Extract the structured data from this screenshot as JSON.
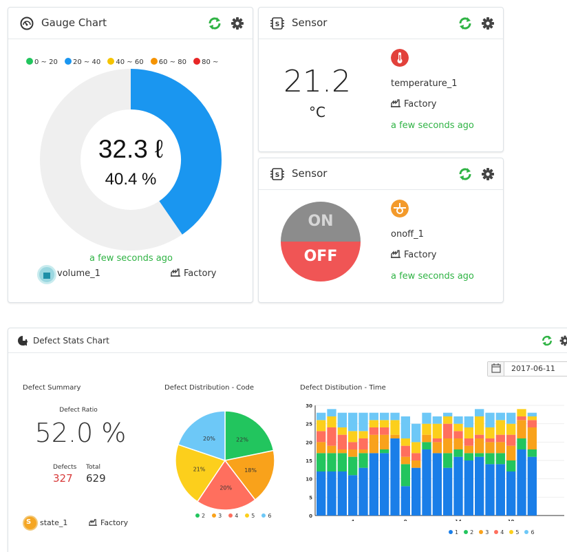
{
  "gauge": {
    "title": "Gauge Chart",
    "legend": [
      {
        "label": "0 ~ 20",
        "color": "#22c55e"
      },
      {
        "label": "20 ~ 40",
        "color": "#1a96f0"
      },
      {
        "label": "40 ~ 60",
        "color": "#f5c400"
      },
      {
        "label": "60 ~ 80",
        "color": "#f59300"
      },
      {
        "label": "80 ~",
        "color": "#e82626"
      }
    ],
    "value": "32.3 ℓ",
    "percent": "40.4 %",
    "percent_value": 40.4,
    "fill_color": "#1a96f0",
    "updated": "a few seconds ago",
    "sensor_name": "volume_1",
    "location": "Factory"
  },
  "sensor1": {
    "title": "Sensor",
    "value": "21.2",
    "unit": "°C",
    "name": "temperature_1",
    "location": "Factory",
    "updated": "a few seconds ago",
    "icon": "thermometer-icon"
  },
  "sensor2": {
    "title": "Sensor",
    "on_label": "ON",
    "off_label": "OFF",
    "name": "onoff_1",
    "location": "Factory",
    "updated": "a few seconds ago",
    "icon": "switch-icon"
  },
  "defect": {
    "title": "Defect Stats Chart",
    "date": "2017-06-11",
    "summary_title": "Defect Summary",
    "ratio_label": "Defect Ratio",
    "ratio": "52.0 %",
    "defects_label": "Defects",
    "defects": "327",
    "total_label": "Total",
    "total": "629",
    "sensor_name": "state_1",
    "location": "Factory",
    "pie_title": "Defect Distribution - Code",
    "bar_title": "Defect Distibution - Time"
  },
  "colors": {
    "green": "#22c55e",
    "blue": "#1a7ee8",
    "yellow": "#fccf1c",
    "orange": "#f9a21b",
    "coral": "#ff6f5e",
    "sky": "#6dc8f7"
  },
  "chart_data": [
    {
      "type": "pie",
      "title": "Defect Distribution - Code",
      "categories": [
        "2",
        "3",
        "4",
        "5",
        "6"
      ],
      "values": [
        22,
        18,
        20,
        21,
        20
      ],
      "labels": [
        "22%",
        "18%",
        "20%",
        "21%",
        "20%"
      ],
      "colors": [
        "#22c55e",
        "#f9a21b",
        "#ff6f5e",
        "#fccf1c",
        "#6dc8f7"
      ]
    },
    {
      "type": "bar",
      "title": "Defect Distibution - Time",
      "stacked": true,
      "x": [
        1,
        2,
        3,
        4,
        5,
        6,
        7,
        8,
        9,
        10,
        11,
        12,
        13,
        14,
        15,
        16,
        17,
        18,
        19,
        20,
        21
      ],
      "xticks": [
        4,
        9,
        14,
        19
      ],
      "ylim": [
        0,
        30
      ],
      "yticks": [
        0,
        5,
        10,
        15,
        20,
        25,
        30
      ],
      "grid": true,
      "series": [
        {
          "name": "1",
          "color": "#1a7ee8",
          "values": [
            12,
            12,
            12,
            11,
            13,
            17,
            17,
            21,
            8,
            13,
            18,
            17,
            13,
            16,
            15,
            16,
            14,
            14,
            12,
            18,
            16
          ]
        },
        {
          "name": "2",
          "color": "#22c55e",
          "values": [
            5,
            5,
            5,
            5,
            4,
            0,
            1,
            0,
            6,
            0,
            2,
            0,
            4,
            2,
            2,
            1,
            3,
            3,
            3,
            3,
            2
          ]
        },
        {
          "name": "3",
          "color": "#f9a21b",
          "values": [
            3,
            2,
            1,
            2,
            1,
            5,
            4,
            1,
            2,
            2,
            2,
            3,
            4,
            3,
            2,
            4,
            3,
            3,
            4,
            5,
            6
          ]
        },
        {
          "name": "4",
          "color": "#ff6f5e",
          "values": [
            3,
            5,
            4,
            2,
            3,
            2,
            2,
            0,
            3,
            2,
            0,
            1,
            4,
            2,
            2,
            1,
            1,
            2,
            3,
            1,
            2
          ]
        },
        {
          "name": "5",
          "color": "#fccf1c",
          "values": [
            3,
            3,
            2,
            3,
            2,
            2,
            2,
            4,
            2,
            3,
            3,
            4,
            2,
            2,
            3,
            5,
            3,
            4,
            3,
            2,
            1
          ]
        },
        {
          "name": "6",
          "color": "#6dc8f7",
          "values": [
            2,
            2,
            4,
            5,
            5,
            2,
            2,
            2,
            6,
            5,
            3,
            2,
            1,
            2,
            3,
            2,
            4,
            2,
            3,
            0,
            1
          ]
        }
      ]
    }
  ]
}
